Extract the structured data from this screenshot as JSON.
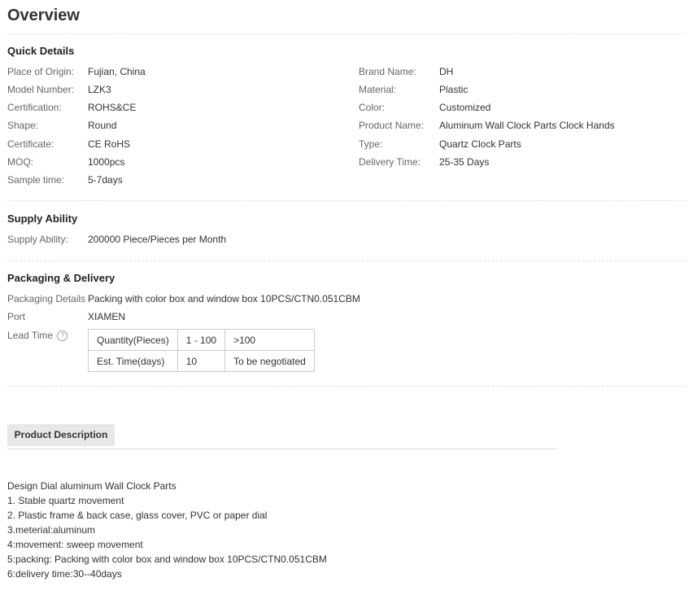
{
  "overview_title": "Overview",
  "quick_details": {
    "title": "Quick Details",
    "left": [
      {
        "label": "Place of Origin:",
        "value": "Fujian, China"
      },
      {
        "label": "Model Number:",
        "value": "LZK3"
      },
      {
        "label": "Certification:",
        "value": "ROHS&CE"
      },
      {
        "label": "Shape:",
        "value": "Round"
      },
      {
        "label": "Certificate:",
        "value": "CE RoHS"
      },
      {
        "label": "MOQ:",
        "value": "1000pcs"
      },
      {
        "label": "Sample time:",
        "value": "5-7days"
      }
    ],
    "right": [
      {
        "label": "Brand Name:",
        "value": "DH"
      },
      {
        "label": "Material:",
        "value": "Plastic"
      },
      {
        "label": "Color:",
        "value": "Customized"
      },
      {
        "label": "Product Name:",
        "value": "Aluminum Wall Clock Parts Clock Hands"
      },
      {
        "label": "Type:",
        "value": "Quartz Clock Parts"
      },
      {
        "label": "Delivery Time:",
        "value": "25-35 Days"
      }
    ]
  },
  "supply_ability": {
    "title": "Supply Ability",
    "label": "Supply Ability:",
    "value": "200000 Piece/Pieces per Month"
  },
  "packaging": {
    "title": "Packaging & Delivery",
    "details_label": "Packaging Details",
    "details_value": "Packing with color box and window box 10PCS/CTN0.051CBM",
    "port_label": "Port",
    "port_value": "XIAMEN",
    "lead_time_label": "Lead Time",
    "help_icon": "question-circle-icon",
    "lead_table": [
      [
        "Quantity(Pieces)",
        "1 - 100",
        ">100"
      ],
      [
        "Est. Time(days)",
        "10",
        "To be negotiated"
      ]
    ]
  },
  "product_description": {
    "tab_label": "Product Description",
    "lines": [
      "Design Dial aluminum Wall Clock Parts",
      "1. Stable quartz movement",
      "2. Plastic frame & back case, glass cover, PVC or paper dial",
      "3.meterial:aluminum",
      "4:movement: sweep movement",
      "5:packing: Packing with color box and window box 10PCS/CTN0.051CBM",
      "6:delivery time:30--40days"
    ]
  }
}
